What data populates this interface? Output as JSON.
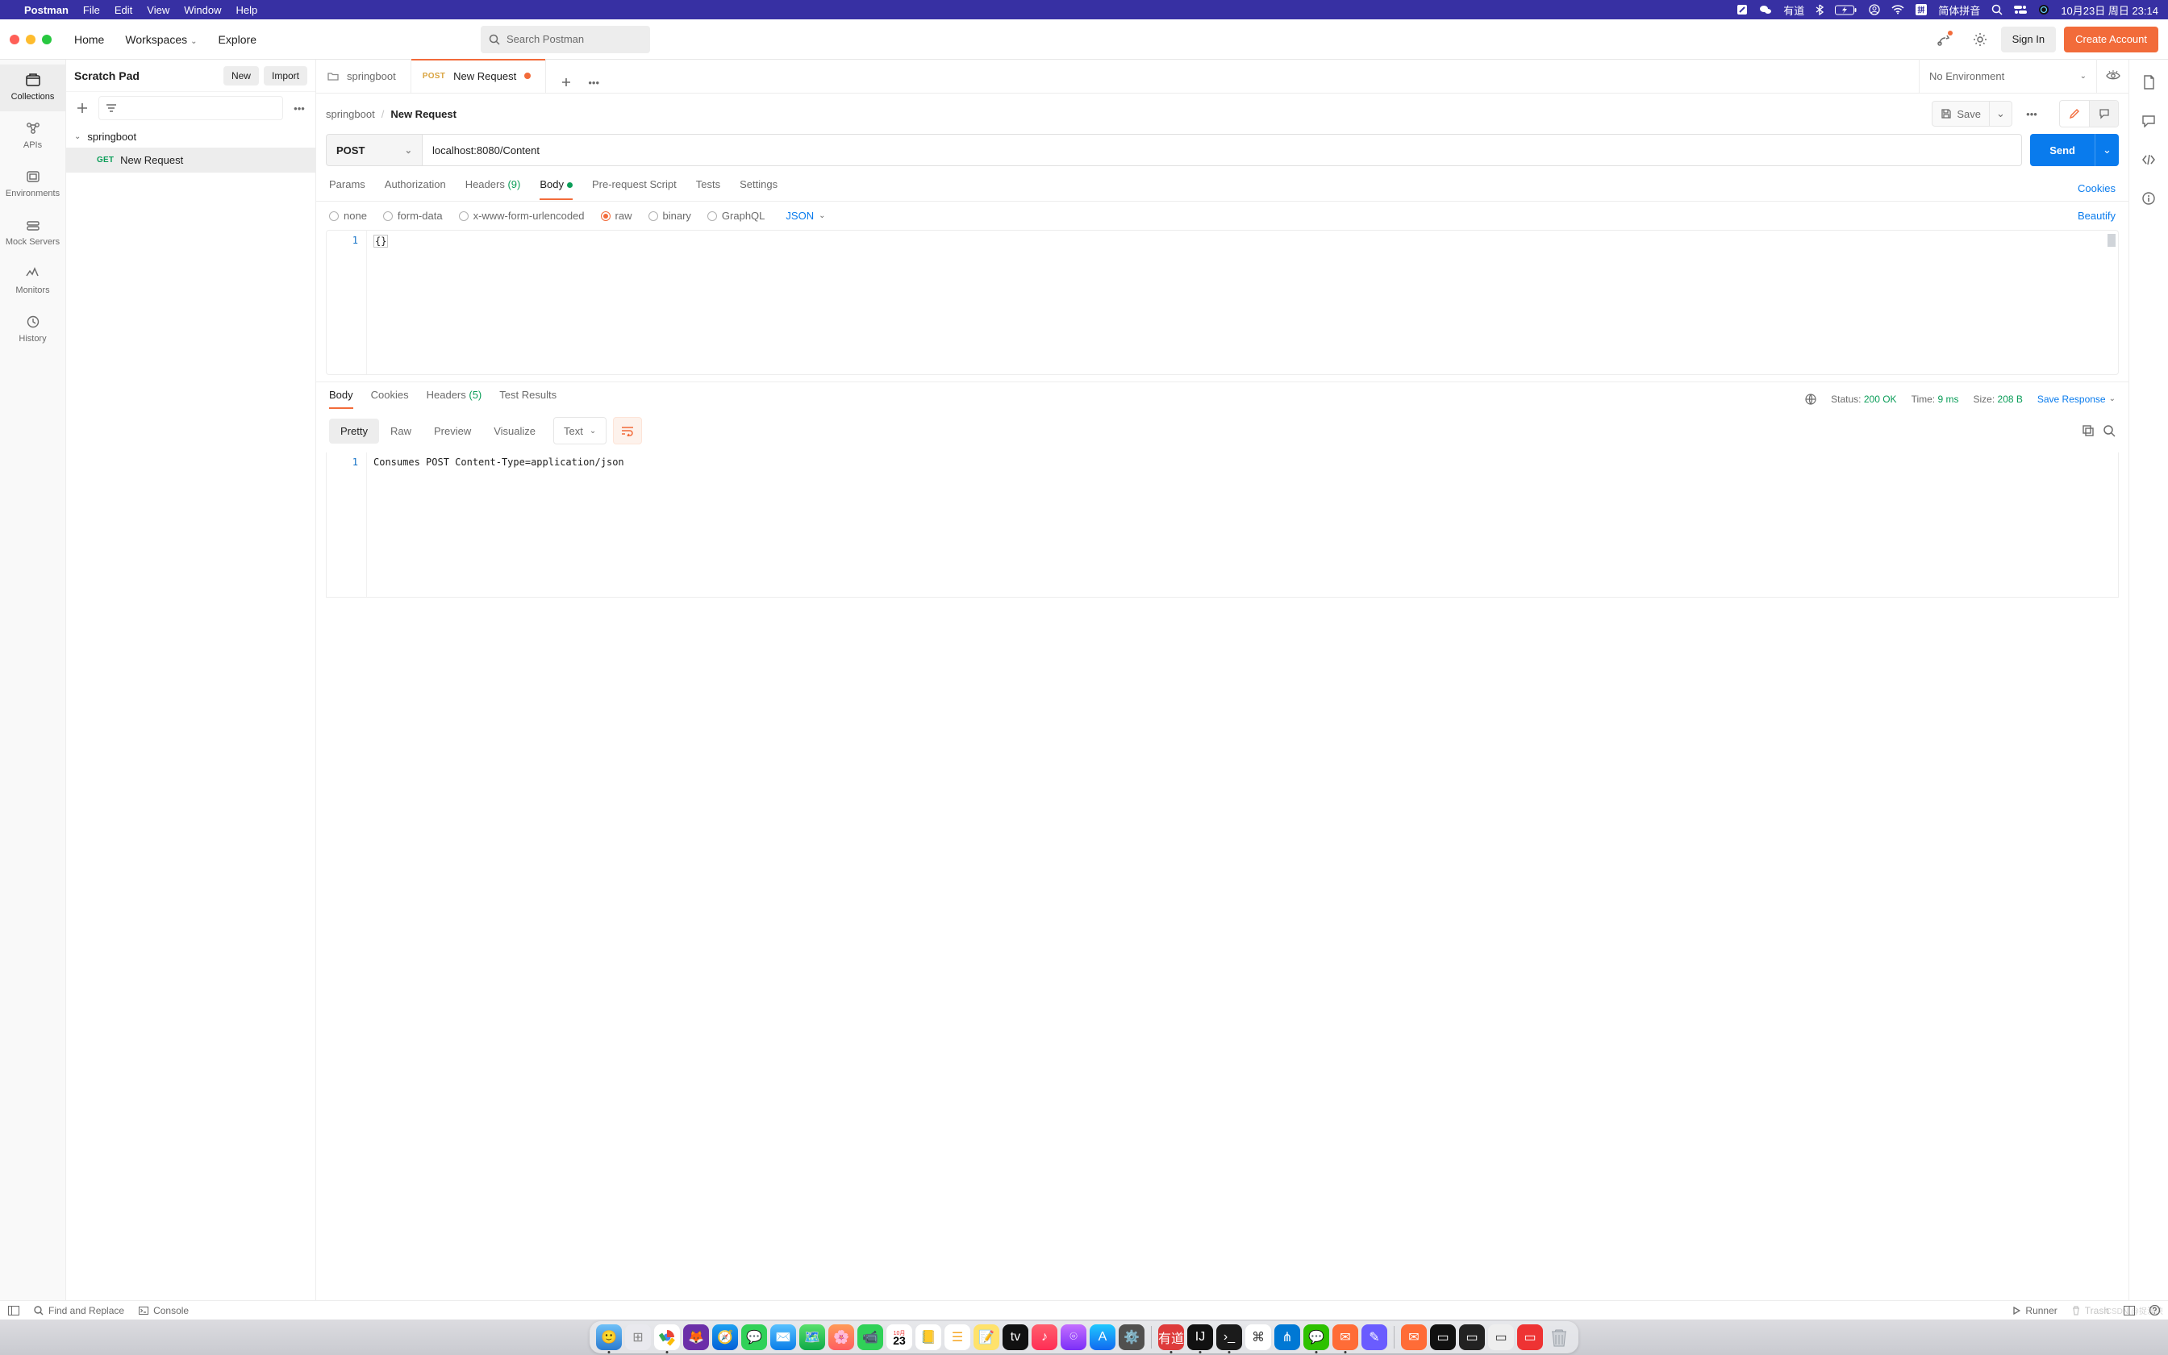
{
  "mac_menubar": {
    "app_name": "Postman",
    "menus": [
      "File",
      "Edit",
      "View",
      "Window",
      "Help"
    ],
    "input_method": "简体拼音",
    "datetime": "10月23日 周日  23:14"
  },
  "toolbar": {
    "nav": {
      "home": "Home",
      "workspaces": "Workspaces",
      "explore": "Explore"
    },
    "search_placeholder": "Search Postman",
    "sign_in": "Sign In",
    "create_account": "Create Account"
  },
  "left_rail": {
    "items": [
      {
        "key": "collections",
        "label": "Collections"
      },
      {
        "key": "apis",
        "label": "APIs"
      },
      {
        "key": "environments",
        "label": "Environments"
      },
      {
        "key": "mock",
        "label": "Mock Servers"
      },
      {
        "key": "monitors",
        "label": "Monitors"
      },
      {
        "key": "history",
        "label": "History"
      }
    ]
  },
  "sidebar": {
    "title": "Scratch Pad",
    "new": "New",
    "import": "Import",
    "collection": {
      "name": "springboot"
    },
    "request": {
      "method": "GET",
      "name": "New Request"
    }
  },
  "tabs": {
    "tab0": {
      "label": "springboot"
    },
    "tab1": {
      "method": "POST",
      "label": "New Request"
    },
    "env": "No Environment"
  },
  "crumb": {
    "collection": "springboot",
    "name": "New Request",
    "save": "Save"
  },
  "url_bar": {
    "method": "POST",
    "url": "localhost:8080/Content",
    "send": "Send"
  },
  "req_tabs": {
    "params": "Params",
    "auth": "Authorization",
    "headers_label": "Headers",
    "headers_count": "(9)",
    "body": "Body",
    "prs": "Pre-request Script",
    "tests": "Tests",
    "settings": "Settings",
    "cookies": "Cookies"
  },
  "body": {
    "types": {
      "none": "none",
      "form_data": "form-data",
      "xwww": "x-www-form-urlencoded",
      "raw": "raw",
      "binary": "binary",
      "graphql": "GraphQL"
    },
    "raw_type": "JSON",
    "beautify": "Beautify",
    "content": "{}"
  },
  "response": {
    "tabs": {
      "body": "Body",
      "cookies": "Cookies",
      "headers_label": "Headers",
      "headers_count": "(5)",
      "tests": "Test Results"
    },
    "status_label": "Status:",
    "status_value": "200 OK",
    "time_label": "Time:",
    "time_value": "9 ms",
    "size_label": "Size:",
    "size_value": "208 B",
    "save_response": "Save Response",
    "fmt": {
      "pretty": "Pretty",
      "raw": "Raw",
      "preview": "Preview",
      "visualize": "Visualize",
      "type": "Text"
    },
    "body_text": "Consumes POST  Content-Type=application/json"
  },
  "statusbar": {
    "find": "Find and Replace",
    "console": "Console",
    "runner": "Runner",
    "trash": "Trash"
  },
  "right_rail": {},
  "watermark": "CSDN @捉漠侠"
}
